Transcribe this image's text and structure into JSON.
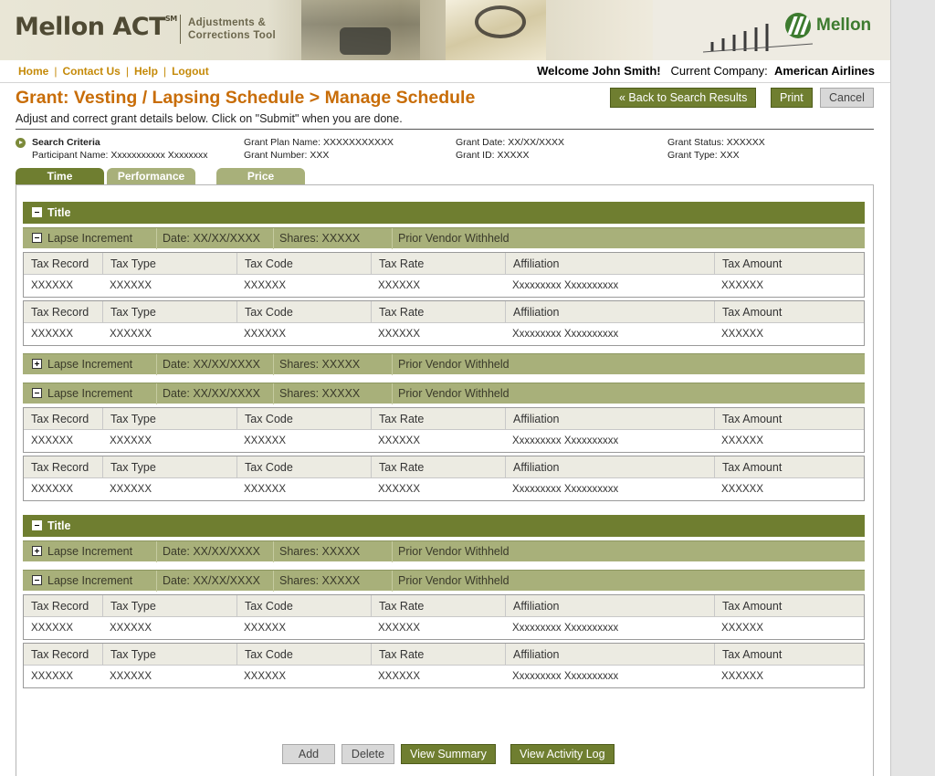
{
  "brand": {
    "name": "Mellon ACT",
    "sup": "SM",
    "tagline_line1": "Adjustments &",
    "tagline_line2": "Corrections Tool",
    "logo_word": "Mellon"
  },
  "nav": {
    "home": "Home",
    "contact": "Contact Us",
    "help": "Help",
    "logout": "Logout",
    "sep": "|"
  },
  "welcome": {
    "greeting": "Welcome John Smith!",
    "company_label": "Current Company:",
    "company": "American Airlines"
  },
  "page": {
    "title": "Grant: Vesting / Lapsing Schedule > Manage Schedule",
    "subtitle": "Adjust and correct grant details below. Click on \"Submit\" when you are done."
  },
  "header_buttons": {
    "back": "« Back to Search Results",
    "print": "Print",
    "cancel": "Cancel"
  },
  "criteria": {
    "heading": "Search Criteria",
    "participant": "Participant Name: Xxxxxxxxxxx Xxxxxxxx",
    "plan_name": "Grant Plan Name: XXXXXXXXXXX",
    "grant_number": "Grant Number: XXX",
    "grant_date": "Grant Date: XX/XX/XXXX",
    "grant_id": "Grant ID: XXXXX",
    "grant_status": "Grant Status: XXXXXX",
    "grant_type": "Grant Type: XXX"
  },
  "tabs": [
    "Time",
    "Performance",
    "Price"
  ],
  "section_title": "Title",
  "lapse": {
    "label": "Lapse Increment",
    "date": "Date:  XX/XX/XXXX",
    "shares": "Shares:  XXXXX",
    "vendor": "Prior Vendor Withheld"
  },
  "table": {
    "headers": [
      "Tax Record",
      "Tax Type",
      "Tax Code",
      "Tax Rate",
      "Affiliation",
      "Tax Amount"
    ],
    "row": [
      "XXXXXX",
      "XXXXXX",
      "XXXXXX",
      "XXXXXX",
      "Xxxxxxxxx Xxxxxxxxxx",
      "XXXXXX"
    ]
  },
  "footer_buttons": {
    "add": "Add",
    "delete": "Delete",
    "view_summary": "View Summary",
    "view_log": "View Activity Log"
  }
}
